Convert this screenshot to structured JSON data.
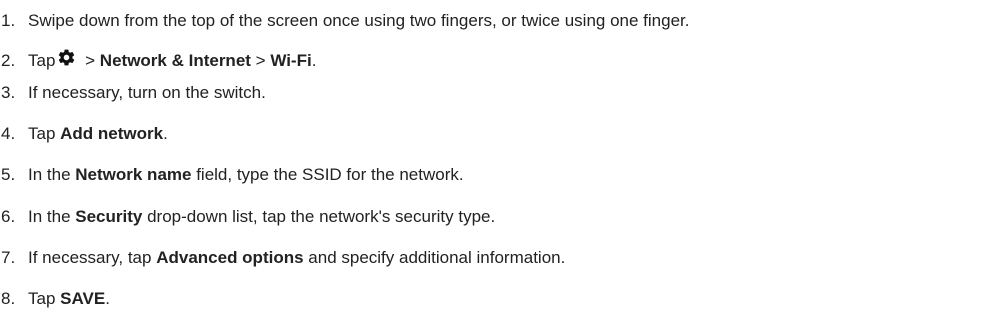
{
  "steps": [
    {
      "number": "1.",
      "text": "Swipe down from the top of the screen once using two fingers, or twice using one finger."
    },
    {
      "number": "2.",
      "before": "Tap",
      "icon": "gear-icon",
      "sep1": " > ",
      "bold1": "Network & Internet",
      "sep2": " > ",
      "bold2": "Wi-Fi",
      "after": "."
    },
    {
      "number": "3.",
      "text": "If necessary, turn on the switch."
    },
    {
      "number": "4.",
      "before": "Tap ",
      "bold": "Add network",
      "after": "."
    },
    {
      "number": "5.",
      "before": "In the ",
      "bold": "Network name",
      "after": " field, type the SSID for the network."
    },
    {
      "number": "6.",
      "before": "In the ",
      "bold": "Security",
      "after": " drop-down list, tap the network's security type."
    },
    {
      "number": "7.",
      "before": "If necessary, tap ",
      "bold": "Advanced options",
      "after": " and specify additional information."
    },
    {
      "number": "8.",
      "before": "Tap ",
      "bold": "SAVE",
      "after": "."
    }
  ]
}
